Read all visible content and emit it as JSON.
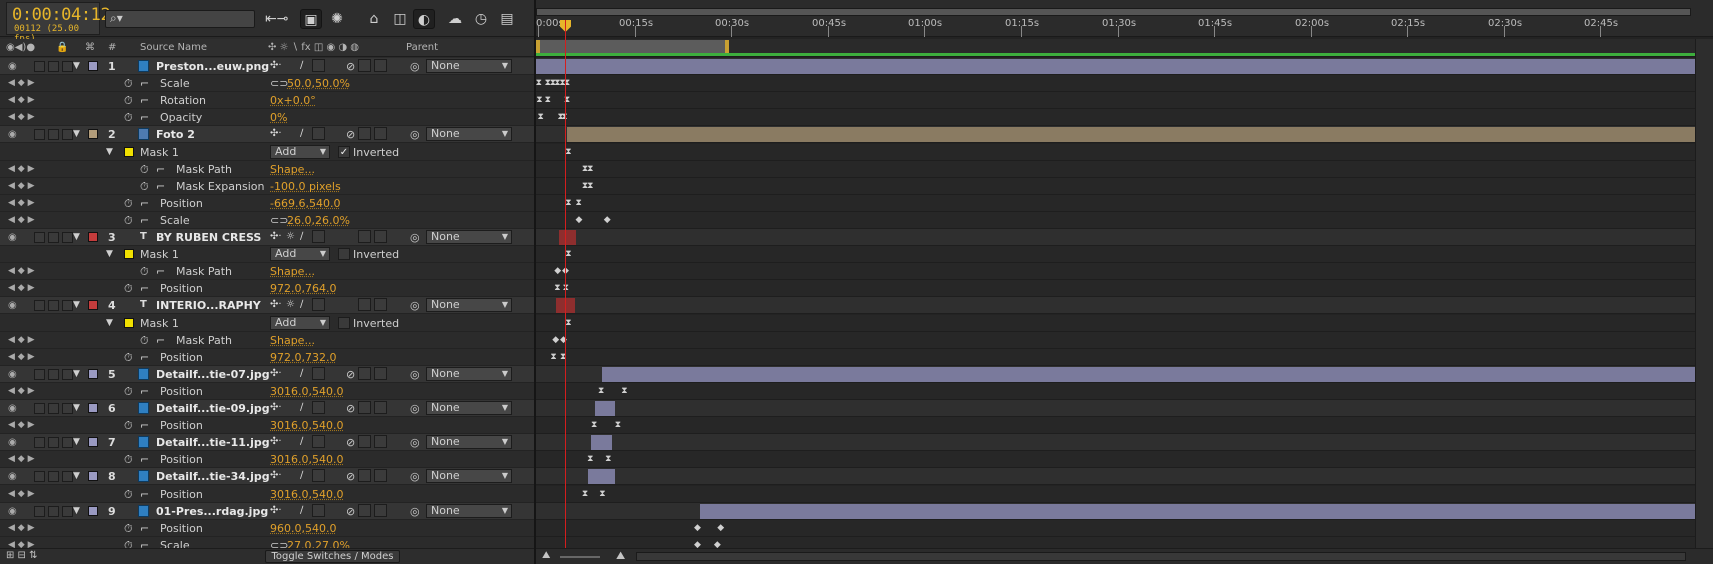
{
  "timecode": {
    "current": "0:00:04:12",
    "frames": "00112 (25.00 fps)"
  },
  "search": {
    "placeholder": ""
  },
  "columns": {
    "source_name": "Source Name",
    "number": "#",
    "parent": "Parent"
  },
  "ruler_labels": [
    "0:00s",
    "00:15s",
    "00:30s",
    "00:45s",
    "01:00s",
    "01:15s",
    "01:30s",
    "01:45s",
    "02:00s",
    "02:15s",
    "02:30s",
    "02:45s"
  ],
  "toggle_label": "Toggle Switches / Modes",
  "parent_none": "None",
  "rows": [
    {
      "type": "layer",
      "num": "1",
      "name": "Preston...euw.png",
      "color": "#9a9ac2",
      "icon": "footage",
      "parent": "None"
    },
    {
      "type": "prop",
      "name": "Scale",
      "value": "50.0,50.0%",
      "link": true
    },
    {
      "type": "prop",
      "name": "Rotation",
      "value": "0x+0.0°"
    },
    {
      "type": "prop",
      "name": "Opacity",
      "value": "0%"
    },
    {
      "type": "layer",
      "num": "2",
      "name": "Foto 2",
      "color": "#b29c7a",
      "icon": "comp",
      "parent": "None"
    },
    {
      "type": "mask",
      "name": "Mask 1",
      "mode": "Add",
      "inverted_label": "Inverted",
      "inverted": true
    },
    {
      "type": "maskprop",
      "name": "Mask Path",
      "value": "Shape..."
    },
    {
      "type": "maskprop",
      "name": "Mask Expansion",
      "value": "-100.0 pixels"
    },
    {
      "type": "prop",
      "name": "Position",
      "value": "-669.6,540.0"
    },
    {
      "type": "prop",
      "name": "Scale",
      "value": "26.0,26.0%",
      "link": true
    },
    {
      "type": "layer",
      "num": "3",
      "name": "BY RUBEN CRESS",
      "color": "#c43c3c",
      "icon": "text",
      "parent": "None"
    },
    {
      "type": "mask",
      "name": "Mask 1",
      "mode": "Add",
      "inverted_label": "Inverted",
      "inverted": false
    },
    {
      "type": "maskprop",
      "name": "Mask Path",
      "value": "Shape..."
    },
    {
      "type": "prop",
      "name": "Position",
      "value": "972.0,764.0"
    },
    {
      "type": "layer",
      "num": "4",
      "name": "INTERIO...RAPHY",
      "color": "#c43c3c",
      "icon": "text",
      "parent": "None"
    },
    {
      "type": "mask",
      "name": "Mask 1",
      "mode": "Add",
      "inverted_label": "Inverted",
      "inverted": false
    },
    {
      "type": "maskprop",
      "name": "Mask Path",
      "value": "Shape..."
    },
    {
      "type": "prop",
      "name": "Position",
      "value": "972.0,732.0"
    },
    {
      "type": "layer",
      "num": "5",
      "name": "Detailf...tie-07.jpg",
      "color": "#9a9ac2",
      "icon": "footage",
      "parent": "None"
    },
    {
      "type": "prop",
      "name": "Position",
      "value": "3016.0,540.0"
    },
    {
      "type": "layer",
      "num": "6",
      "name": "Detailf...tie-09.jpg",
      "color": "#9a9ac2",
      "icon": "footage",
      "parent": "None"
    },
    {
      "type": "prop",
      "name": "Position",
      "value": "3016.0,540.0"
    },
    {
      "type": "layer",
      "num": "7",
      "name": "Detailf...tie-11.jpg",
      "color": "#9a9ac2",
      "icon": "footage",
      "parent": "None"
    },
    {
      "type": "prop",
      "name": "Position",
      "value": "3016.0,540.0"
    },
    {
      "type": "layer",
      "num": "8",
      "name": "Detailf...tie-34.jpg",
      "color": "#9a9ac2",
      "icon": "footage",
      "parent": "None"
    },
    {
      "type": "prop",
      "name": "Position",
      "value": "3016.0,540.0"
    },
    {
      "type": "layer",
      "num": "9",
      "name": "01-Pres...rdag.jpg",
      "color": "#9a9ac2",
      "icon": "footage",
      "parent": "None"
    },
    {
      "type": "prop",
      "name": "Position",
      "value": "960.0,540.0"
    },
    {
      "type": "prop",
      "name": "Scale",
      "value": "27.0,27.0%",
      "link": true
    }
  ],
  "timeline": {
    "duration_seconds": 180,
    "current_seconds": 4.48,
    "work_area_end_seconds": 30,
    "bars": [
      {
        "row": 0,
        "start": 0,
        "end": 180,
        "color": "#7a7a9c"
      },
      {
        "row": 4,
        "start": 4.8,
        "end": 180,
        "color": "#8a7b62"
      },
      {
        "row": 10,
        "start": 3.5,
        "end": 6.2,
        "color": "#8e2e2e"
      },
      {
        "row": 14,
        "start": 3.1,
        "end": 6.0,
        "color": "#8e2e2e"
      },
      {
        "row": 18,
        "start": 10.2,
        "end": 180,
        "color": "#7a7a9c"
      },
      {
        "row": 20,
        "start": 9.2,
        "end": 12.3,
        "color": "#7a7a9c"
      },
      {
        "row": 22,
        "start": 8.6,
        "end": 11.8,
        "color": "#7a7a9c"
      },
      {
        "row": 24,
        "start": 8.1,
        "end": 12.3,
        "color": "#7a7a9c"
      },
      {
        "row": 26,
        "start": 25.5,
        "end": 180,
        "color": "#7a7a9c"
      }
    ],
    "keyframes": [
      {
        "row": 1,
        "times": [
          0.4,
          1.8,
          2.6,
          3.3,
          4.1,
          4.8
        ],
        "shape": "hourglass"
      },
      {
        "row": 2,
        "times": [
          0.5,
          1.8,
          4.8
        ],
        "shape": "hourglass"
      },
      {
        "row": 3,
        "times": [
          0.7,
          3.8,
          4.4
        ],
        "shape": "hourglass"
      },
      {
        "row": 5,
        "times": [
          5.0
        ],
        "shape": "hourglass"
      },
      {
        "row": 6,
        "times": [
          7.6,
          8.4
        ],
        "shape": "hourglass"
      },
      {
        "row": 7,
        "times": [
          7.6,
          8.4
        ],
        "shape": "hourglass"
      },
      {
        "row": 8,
        "times": [
          5.0,
          6.6
        ],
        "shape": "hourglass"
      },
      {
        "row": 9,
        "times": [
          6.6,
          11.0
        ],
        "shape": "diamond"
      },
      {
        "row": 11,
        "times": [
          5.0
        ],
        "shape": "hourglass"
      },
      {
        "row": 12,
        "times": [
          3.3,
          4.5
        ],
        "shape": "diamond"
      },
      {
        "row": 13,
        "times": [
          3.3,
          4.6
        ],
        "shape": "hourglass"
      },
      {
        "row": 15,
        "times": [
          5.0
        ],
        "shape": "hourglass"
      },
      {
        "row": 16,
        "times": [
          3.0,
          4.2
        ],
        "shape": "diamond"
      },
      {
        "row": 17,
        "times": [
          2.7,
          4.2
        ],
        "shape": "hourglass"
      },
      {
        "row": 19,
        "times": [
          10.1,
          13.7
        ],
        "shape": "hourglass"
      },
      {
        "row": 21,
        "times": [
          9.0,
          12.7
        ],
        "shape": "hourglass"
      },
      {
        "row": 23,
        "times": [
          8.4,
          11.2
        ],
        "shape": "hourglass"
      },
      {
        "row": 25,
        "times": [
          7.6,
          10.3
        ],
        "shape": "hourglass"
      },
      {
        "row": 27,
        "times": [
          25.0,
          28.6
        ],
        "shape": "diamond"
      },
      {
        "row": 28,
        "times": [
          25.0,
          28.1
        ],
        "shape": "diamond"
      }
    ]
  }
}
